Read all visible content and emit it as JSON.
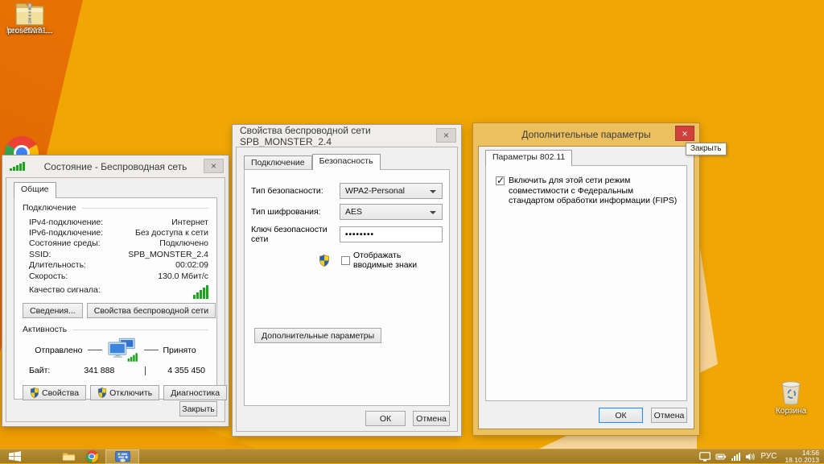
{
  "desktop": {
    "icon1_label": "heci-20131...",
    "icon2_label": "prosetwm-...",
    "recycle_label": "Корзина"
  },
  "status_dialog": {
    "title": "Состояние - Беспроводная сеть",
    "close_x": "×",
    "tab": "Общие",
    "connection_group": "Подключение",
    "rows": [
      {
        "label": "IPv4-подключение:",
        "value": "Интернет"
      },
      {
        "label": "IPv6-подключение:",
        "value": "Без доступа к сети"
      },
      {
        "label": "Состояние среды:",
        "value": "Подключено"
      },
      {
        "label": "SSID:",
        "value": "SPB_MONSTER_2.4"
      },
      {
        "label": "Длительность:",
        "value": "00:02:09"
      },
      {
        "label": "Скорость:",
        "value": "130.0 Мбит/с"
      }
    ],
    "signal_label": "Качество сигнала:",
    "details_button": "Сведения...",
    "wireless_props_button": "Свойства беспроводной сети",
    "activity_group": "Активность",
    "sent_label": "Отправлено",
    "received_label": "Принято",
    "bytes_label": "Байт:",
    "bytes_sent": "341 888",
    "bytes_received": "4 355 450",
    "properties_button": "Свойства",
    "disable_button": "Отключить",
    "diagnostics_button": "Диагностика",
    "close_button": "Закрыть"
  },
  "properties_dialog": {
    "title": "Свойства беспроводной сети SPB_MONSTER_2.4",
    "close_x": "×",
    "tabs": [
      {
        "label": "Подключение"
      },
      {
        "label": "Безопасность"
      }
    ],
    "security_type_label": "Тип безопасности:",
    "security_type_value": "WPA2-Personal",
    "encryption_type_label": "Тип шифрования:",
    "encryption_type_value": "AES",
    "key_label": "Ключ безопасности сети",
    "key_value": "••••••••",
    "show_chars_label": "Отображать вводимые знаки",
    "advanced_button": "Дополнительные параметры",
    "ok_button": "ОК",
    "cancel_button": "Отмена"
  },
  "advanced_dialog": {
    "title": "Дополнительные параметры",
    "close_x": "×",
    "close_tooltip": "Закрыть",
    "tab": "Параметры 802.11",
    "fips_checkbox_label": "Включить для этой сети режим совместимости с Федеральным стандартом обработки информации (FIPS)",
    "ok_button": "ОК",
    "cancel_button": "Отмена"
  },
  "taskbar": {
    "language": "РУС",
    "time": "14:56",
    "date": "18.10.2013"
  }
}
